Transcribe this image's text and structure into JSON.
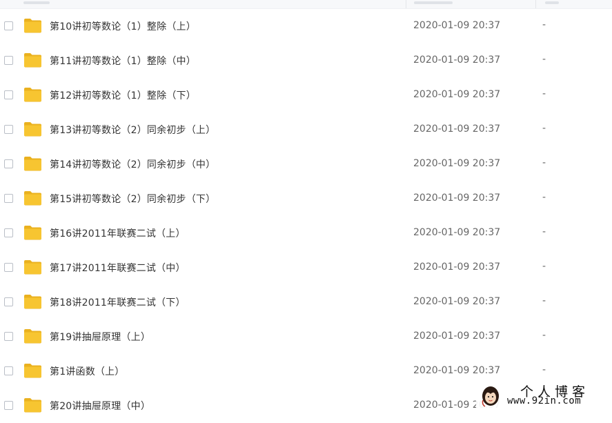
{
  "files": [
    {
      "name": "第10讲初等数论（1）整除（上）",
      "modified": "2020-01-09 20:37",
      "size": "-"
    },
    {
      "name": "第11讲初等数论（1）整除（中）",
      "modified": "2020-01-09 20:37",
      "size": "-"
    },
    {
      "name": "第12讲初等数论（1）整除（下）",
      "modified": "2020-01-09 20:37",
      "size": "-"
    },
    {
      "name": "第13讲初等数论（2）同余初步（上）",
      "modified": "2020-01-09 20:37",
      "size": "-"
    },
    {
      "name": "第14讲初等数论（2）同余初步（中）",
      "modified": "2020-01-09 20:37",
      "size": "-"
    },
    {
      "name": "第15讲初等数论（2）同余初步（下）",
      "modified": "2020-01-09 20:37",
      "size": "-"
    },
    {
      "name": "第16讲2011年联赛二试（上）",
      "modified": "2020-01-09 20:37",
      "size": "-"
    },
    {
      "name": "第17讲2011年联赛二试（中）",
      "modified": "2020-01-09 20:37",
      "size": "-"
    },
    {
      "name": "第18讲2011年联赛二试（下）",
      "modified": "2020-01-09 20:37",
      "size": "-"
    },
    {
      "name": "第19讲抽屉原理（上）",
      "modified": "2020-01-09 20:37",
      "size": "-"
    },
    {
      "name": "第1讲函数（上）",
      "modified": "2020-01-09 20:37",
      "size": "-"
    },
    {
      "name": "第20讲抽屉原理（中）",
      "modified": "2020-01-09 20:37",
      "size": "-"
    }
  ],
  "colors": {
    "folder": "#f7c531",
    "folder_back": "#eab11f"
  },
  "watermark": {
    "title": "个人博客",
    "url": "www.92in.com"
  }
}
